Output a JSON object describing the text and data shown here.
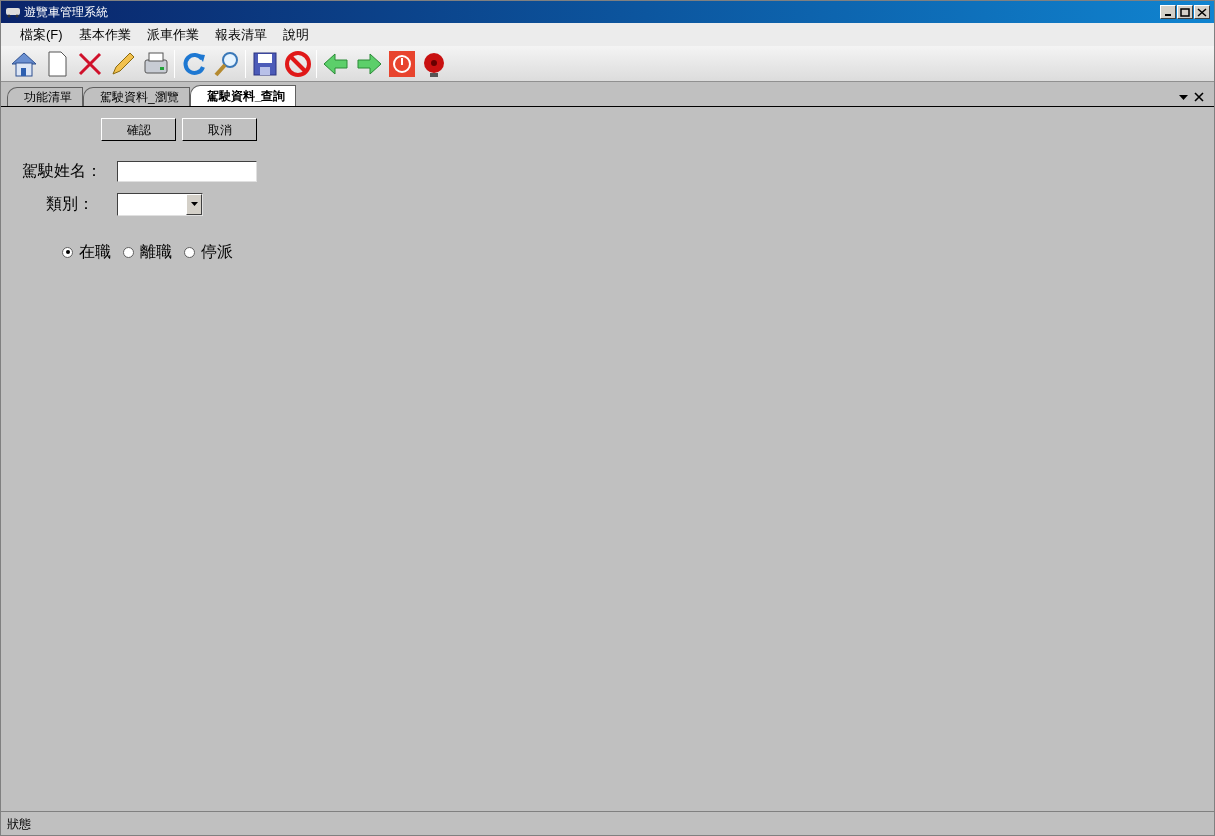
{
  "window": {
    "title": "遊覽車管理系統"
  },
  "menu": [
    {
      "label": "檔案(F)"
    },
    {
      "label": "基本作業"
    },
    {
      "label": "派車作業"
    },
    {
      "label": "報表清單"
    },
    {
      "label": "說明"
    }
  ],
  "tabs": [
    {
      "label": "功能清單",
      "selected": false
    },
    {
      "label": "駕駛資料_瀏覽",
      "selected": false
    },
    {
      "label": "駕駛資料_查詢",
      "selected": true
    }
  ],
  "buttons": [
    {
      "label": "確認"
    },
    {
      "label": "取消"
    }
  ],
  "form": {
    "name_label": "駕駛姓名：",
    "category_label": "類別："
  },
  "status_options": [
    {
      "label": "在職",
      "selected": true
    },
    {
      "label": "離職",
      "selected": false
    },
    {
      "label": "停派",
      "selected": false
    }
  ],
  "status_bar": {
    "text": "狀態"
  }
}
